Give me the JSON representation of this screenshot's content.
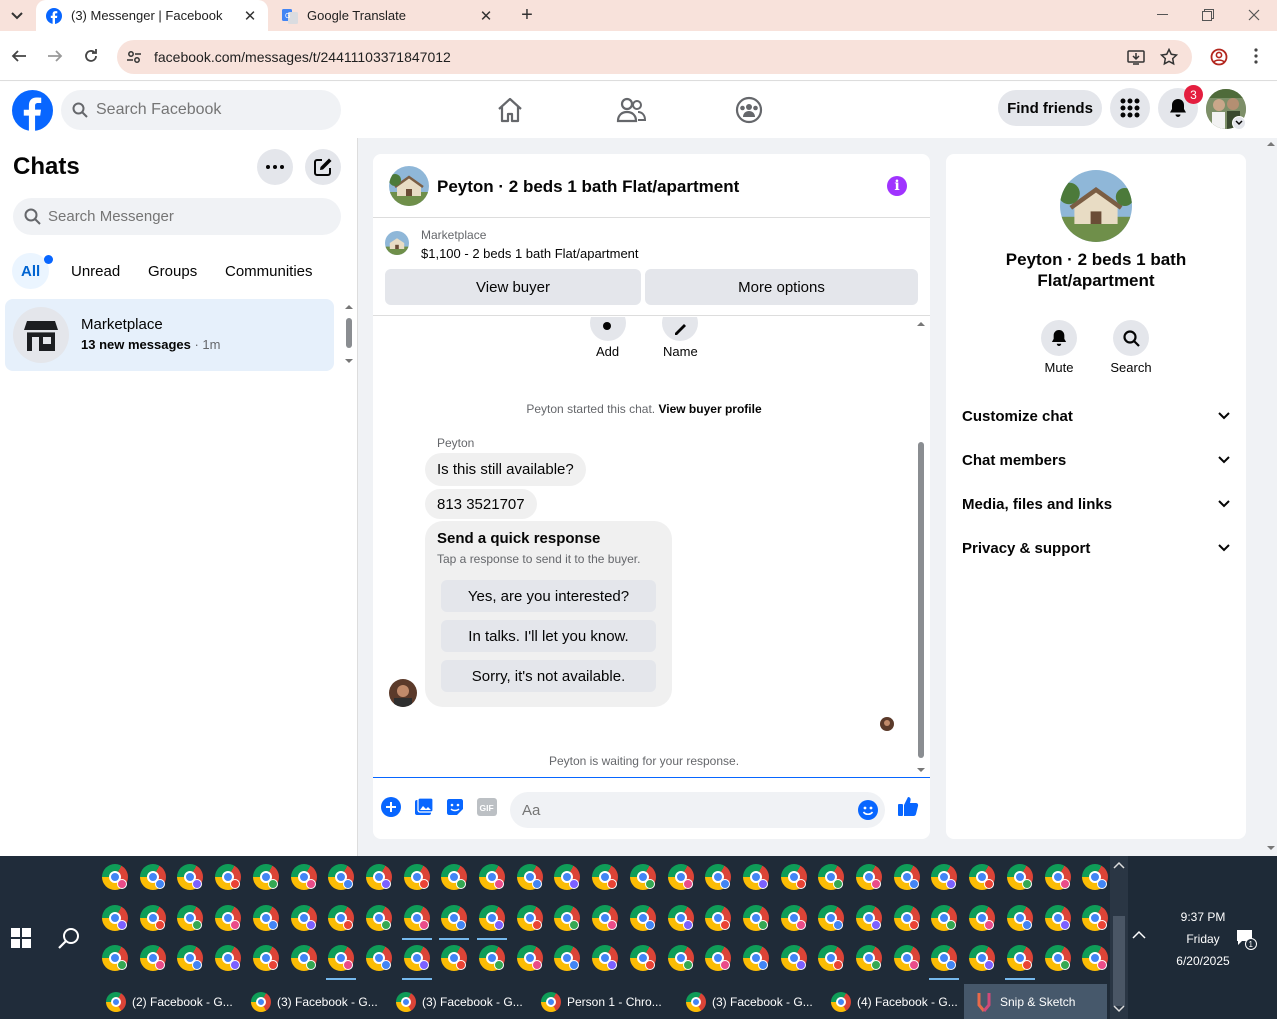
{
  "browser": {
    "tabs": [
      {
        "title": "(3) Messenger | Facebook",
        "active": true
      },
      {
        "title": "Google Translate",
        "active": false
      }
    ],
    "url": "facebook.com/messages/t/24411103371847012"
  },
  "fb_header": {
    "search_placeholder": "Search Facebook",
    "find_friends": "Find friends",
    "notification_count": "3"
  },
  "chats": {
    "title": "Chats",
    "search_placeholder": "Search Messenger",
    "filters": [
      "All",
      "Unread",
      "Groups",
      "Communities"
    ],
    "items": [
      {
        "name": "Marketplace",
        "preview": "13 new messages",
        "time": " · 1m"
      }
    ]
  },
  "conversation": {
    "title": "Peyton · 2 beds 1 bath Flat/apartment",
    "marketplace_label": "Marketplace",
    "listing": "$1,100 - 2 beds 1 bath Flat/apartment",
    "view_buyer": "View buyer",
    "more_options": "More options",
    "top_actions": [
      "Add",
      "Name"
    ],
    "started_text": "Peyton started this chat.",
    "view_buyer_profile": "View buyer profile",
    "sender": "Peyton",
    "messages": [
      "Is this still available?",
      "813 3521707"
    ],
    "quick_response": {
      "title": "Send a quick response",
      "subtitle": "Tap a response to send it to the buyer.",
      "options": [
        "Yes, are you interested?",
        "In talks. I'll let you know.",
        "Sorry, it's not available."
      ]
    },
    "waiting": "Peyton is waiting for your response.",
    "composer_placeholder": "Aa"
  },
  "details": {
    "title": "Peyton · 2 beds 1 bath Flat/apartment",
    "actions": [
      "Mute",
      "Search"
    ],
    "sections": [
      "Customize chat",
      "Chat members",
      "Media, files and links",
      "Privacy & support"
    ]
  },
  "taskbar": {
    "items": [
      {
        "label": "(2) Facebook - G..."
      },
      {
        "label": "(3) Facebook - G..."
      },
      {
        "label": "(3) Facebook - G..."
      },
      {
        "label": "Person 1 - Chro..."
      },
      {
        "label": "(3) Facebook - G..."
      },
      {
        "label": "(4) Facebook - G..."
      },
      {
        "label": "Snip & Sketch"
      }
    ],
    "time": "9:37 PM",
    "day": "Friday",
    "date": "6/20/2025",
    "notification_count": "1"
  },
  "colors": {
    "fb_blue": "#0866ff",
    "tab_bar": "#f8e2db",
    "selected_chat": "#e6f0fb",
    "info_purple": "#a033ff",
    "badge_red": "#e41e3f",
    "taskbar": "#1f2b38"
  }
}
